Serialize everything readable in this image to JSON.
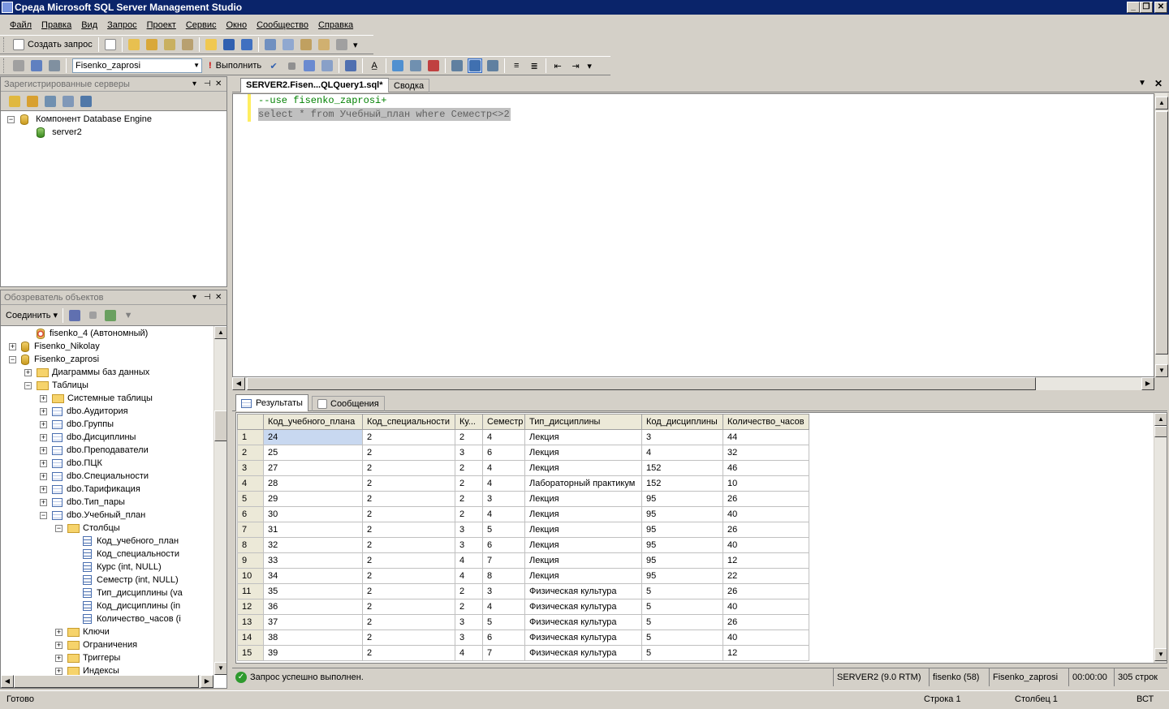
{
  "window": {
    "title": "Среда Microsoft SQL Server Management Studio"
  },
  "menu": [
    "Файл",
    "Правка",
    "Вид",
    "Запрос",
    "Проект",
    "Сервис",
    "Окно",
    "Сообщество",
    "Справка"
  ],
  "toolbar1": {
    "new_query": "Создать запрос"
  },
  "toolbar2": {
    "database": "Fisenko_zaprosi",
    "execute": "Выполнить"
  },
  "registered_servers": {
    "title": "Зарегистрированные серверы",
    "items": [
      {
        "label": "Компонент Database Engine"
      },
      {
        "label": "server2"
      }
    ]
  },
  "object_explorer": {
    "title": "Обозреватель объектов",
    "connect": "Соединить",
    "tree": [
      {
        "label": "fisenko_4 (Автономный)",
        "icon": "db-offline-icon"
      },
      {
        "label": "Fisenko_Nikolay",
        "icon": "database-icon"
      },
      {
        "label": "Fisenko_zaprosi",
        "icon": "database-icon"
      },
      {
        "label": "Диаграммы баз данных",
        "icon": "folder-icon"
      },
      {
        "label": "Таблицы",
        "icon": "folder-icon"
      },
      {
        "label": "Системные таблицы",
        "icon": "folder-icon"
      },
      {
        "label": "dbo.Аудитория",
        "icon": "table-icon"
      },
      {
        "label": "dbo.Группы",
        "icon": "table-icon"
      },
      {
        "label": "dbo.Дисциплины",
        "icon": "table-icon"
      },
      {
        "label": "dbo.Преподаватели",
        "icon": "table-icon"
      },
      {
        "label": "dbo.ПЦК",
        "icon": "table-icon"
      },
      {
        "label": "dbo.Специальности",
        "icon": "table-icon"
      },
      {
        "label": "dbo.Тарификация",
        "icon": "table-icon"
      },
      {
        "label": "dbo.Тип_пары",
        "icon": "table-icon"
      },
      {
        "label": "dbo.Учебный_план",
        "icon": "table-icon"
      },
      {
        "label": "Столбцы",
        "icon": "folder-icon"
      },
      {
        "label": "Код_учебного_план",
        "icon": "column-icon"
      },
      {
        "label": "Код_специальности",
        "icon": "column-icon"
      },
      {
        "label": "Курс (int, NULL)",
        "icon": "column-icon"
      },
      {
        "label": "Семестр (int, NULL)",
        "icon": "column-icon"
      },
      {
        "label": "Тип_дисциплины (va",
        "icon": "column-icon"
      },
      {
        "label": "Код_дисциплины (in",
        "icon": "column-icon"
      },
      {
        "label": "Количество_часов (i",
        "icon": "column-icon"
      },
      {
        "label": "Ключи",
        "icon": "folder-icon"
      },
      {
        "label": "Ограничения",
        "icon": "folder-icon"
      },
      {
        "label": "Триггеры",
        "icon": "folder-icon"
      },
      {
        "label": "Индексы",
        "icon": "folder-icon"
      }
    ]
  },
  "tabs": [
    {
      "label": "SERVER2.Fisen...QLQuery1.sql*"
    },
    {
      "label": "Сводка"
    }
  ],
  "editor": {
    "line1": "--use fisenko_zaprosi+",
    "line2": "select * from Учебный_план where Семестр<>2"
  },
  "results_tabs": [
    {
      "label": "Результаты"
    },
    {
      "label": "Сообщения"
    }
  ],
  "grid": {
    "columns": [
      "Код_учебного_плана",
      "Код_специальности",
      "Ку...",
      "Семестр",
      "Тип_дисциплины",
      "Код_дисциплины",
      "Количество_часов"
    ],
    "rows": [
      [
        "1",
        "24",
        "2",
        "2",
        "4",
        "Лекция",
        "3",
        "44"
      ],
      [
        "2",
        "25",
        "2",
        "3",
        "6",
        "Лекция",
        "4",
        "32"
      ],
      [
        "3",
        "27",
        "2",
        "2",
        "4",
        "Лекция",
        "152",
        "46"
      ],
      [
        "4",
        "28",
        "2",
        "2",
        "4",
        "Лабораторный практикум",
        "152",
        "10"
      ],
      [
        "5",
        "29",
        "2",
        "2",
        "3",
        "Лекция",
        "95",
        "26"
      ],
      [
        "6",
        "30",
        "2",
        "2",
        "4",
        "Лекция",
        "95",
        "40"
      ],
      [
        "7",
        "31",
        "2",
        "3",
        "5",
        "Лекция",
        "95",
        "26"
      ],
      [
        "8",
        "32",
        "2",
        "3",
        "6",
        "Лекция",
        "95",
        "40"
      ],
      [
        "9",
        "33",
        "2",
        "4",
        "7",
        "Лекция",
        "95",
        "12"
      ],
      [
        "10",
        "34",
        "2",
        "4",
        "8",
        "Лекция",
        "95",
        "22"
      ],
      [
        "11",
        "35",
        "2",
        "2",
        "3",
        "Физическая культура",
        "5",
        "26"
      ],
      [
        "12",
        "36",
        "2",
        "2",
        "4",
        "Физическая культура",
        "5",
        "40"
      ],
      [
        "13",
        "37",
        "2",
        "3",
        "5",
        "Физическая культура",
        "5",
        "26"
      ],
      [
        "14",
        "38",
        "2",
        "3",
        "6",
        "Физическая культура",
        "5",
        "40"
      ],
      [
        "15",
        "39",
        "2",
        "4",
        "7",
        "Физическая культура",
        "5",
        "12"
      ]
    ]
  },
  "query_status": {
    "message": "Запрос успешно выполнен.",
    "server": "SERVER2 (9.0 RTM)",
    "user": "fisenko (58)",
    "database": "Fisenko_zaprosi",
    "time": "00:00:00",
    "rows": "305 строк"
  },
  "status": {
    "ready": "Готово",
    "line": "Строка 1",
    "col": "Столбец 1",
    "mode": "ВСТ"
  }
}
